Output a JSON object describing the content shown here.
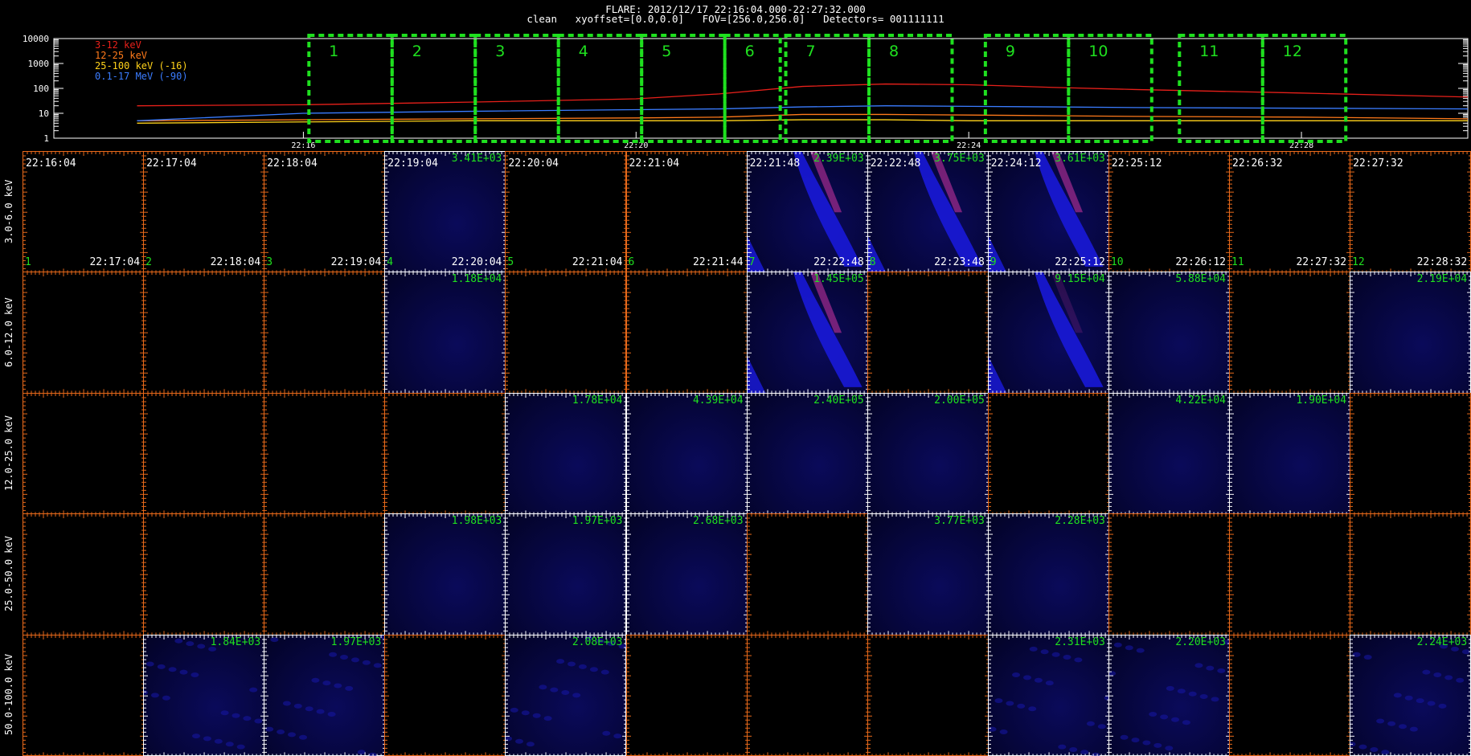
{
  "header": {
    "line1": "FLARE: 2012/12/17 22:16:04.000-22:27:32.000",
    "line2": "clean   xyoffset=[0.0,0.0]   FOV=[256.0,256.0]   Detectors= 001111111"
  },
  "lightcurve": {
    "y_ticks": [
      "10000",
      "1000",
      "100",
      "10",
      "1"
    ],
    "x_ticks": [
      "22:16",
      "22:20",
      "22:24",
      "22:28"
    ],
    "legend": [
      {
        "label": "3-12 keV",
        "color": "#e8201a"
      },
      {
        "label": "12-25 keV",
        "color": "#ff7a1a"
      },
      {
        "label": "25-100 keV (-16)",
        "color": "#ffd21a"
      },
      {
        "label": "0.1-17 MeV (-90)",
        "color": "#3a7cff"
      }
    ],
    "interval_labels": [
      "1",
      "2",
      "3",
      "4",
      "5",
      "6",
      "7",
      "8",
      "9",
      "10",
      "11",
      "12"
    ],
    "interval_color": "#1fe01f"
  },
  "chart_data": {
    "type": "line",
    "title": "FLARE: 2012/12/17 22:16:04.000-22:27:32.000",
    "xlabel": "",
    "ylabel": "",
    "y_scale": "log",
    "ylim": [
      1,
      10000
    ],
    "xlim": [
      "22:13:00",
      "22:30:00"
    ],
    "x": [
      "22:14",
      "22:16",
      "22:18",
      "22:20",
      "22:21",
      "22:22",
      "22:23",
      "22:24",
      "22:25",
      "22:26",
      "22:28",
      "22:30"
    ],
    "series": [
      {
        "name": "3-12 keV",
        "color": "#e8201a",
        "values": [
          20,
          22,
          28,
          38,
          60,
          120,
          150,
          140,
          110,
          90,
          65,
          45
        ]
      },
      {
        "name": "12-25 keV",
        "color": "#ff7a1a",
        "values": [
          5,
          5.5,
          6,
          6.5,
          7,
          9,
          9,
          8.5,
          8,
          7.5,
          7,
          6
        ]
      },
      {
        "name": "25-100 keV (-16)",
        "color": "#ffd21a",
        "values": [
          4,
          4.5,
          5,
          5,
          5,
          5.5,
          5.5,
          5,
          5,
          5,
          5,
          5
        ]
      },
      {
        "name": "0.1-17 MeV (-90)",
        "color": "#3a7cff",
        "values": [
          5,
          10,
          12,
          14,
          15,
          18,
          20,
          19,
          18,
          17,
          16,
          15
        ]
      }
    ]
  },
  "grid": {
    "energy_bands": [
      "3.0-6.0 keV",
      "6.0-12.0 keV",
      "12.0-25.0 keV",
      "25.0-50.0 keV",
      "50.0-100.0 keV"
    ],
    "start_times": [
      "22:16:04",
      "22:17:04",
      "22:18:04",
      "22:19:04",
      "22:20:04",
      "22:21:04",
      "22:21:48",
      "22:22:48",
      "22:24:12",
      "22:25:12",
      "22:26:32",
      "22:27:32"
    ],
    "end_times": [
      "22:17:04",
      "22:18:04",
      "22:19:04",
      "22:20:04",
      "22:21:04",
      "22:21:44",
      "22:22:48",
      "22:23:48",
      "22:25:12",
      "22:26:12",
      "22:27:32",
      "22:28:32"
    ],
    "interval_numbers": [
      "1",
      "2",
      "3",
      "4",
      "5",
      "6",
      "7",
      "8",
      "9",
      "10",
      "11",
      "12"
    ],
    "peaks": [
      [
        "",
        "",
        "",
        "3.41E+03",
        "",
        "",
        "2.39E+03",
        "3.75E+03",
        "3.61E+03",
        "",
        "",
        ""
      ],
      [
        "",
        "",
        "",
        "1.18E+04",
        "",
        "",
        "1.45E+05",
        "",
        "9.15E+04",
        "5.88E+04",
        "",
        "2.19E+04"
      ],
      [
        "",
        "",
        "",
        "",
        "1.78E+04",
        "4.39E+04",
        "2.40E+05",
        "2.00E+05",
        "",
        "4.22E+04",
        "1.90E+04",
        ""
      ],
      [
        "",
        "",
        "",
        "1.98E+03",
        "1.97E+03",
        "2.68E+03",
        "",
        "3.77E+03",
        "2.28E+03",
        "",
        "",
        ""
      ],
      [
        "",
        "1.84E+03",
        "1.97E+03",
        "",
        "2.08E+03",
        "",
        "",
        "",
        "2.31E+03",
        "2.20E+03",
        "",
        "2.24E+03"
      ]
    ],
    "image_type": [
      [
        "none",
        "none",
        "none",
        "faint",
        "none",
        "none",
        "flare",
        "flare",
        "flare",
        "none",
        "none",
        "none"
      ],
      [
        "none",
        "none",
        "none",
        "faint",
        "none",
        "none",
        "flare",
        "none",
        "faint-flare",
        "faint",
        "none",
        "faint"
      ],
      [
        "none",
        "none",
        "none",
        "none",
        "faint",
        "faint",
        "faint",
        "faint",
        "none",
        "faint",
        "faint",
        "none"
      ],
      [
        "none",
        "none",
        "none",
        "faint",
        "faint",
        "faint",
        "none",
        "faint",
        "faint",
        "none",
        "none",
        "none"
      ],
      [
        "none",
        "noise",
        "noise",
        "none",
        "noise",
        "none",
        "none",
        "none",
        "noise",
        "noise",
        "none",
        "noise"
      ]
    ],
    "colors": {
      "axis_image": "#ffffff",
      "axis_empty": "#e8691a",
      "peak": "#1fe01f",
      "time": "#ffffff"
    }
  }
}
